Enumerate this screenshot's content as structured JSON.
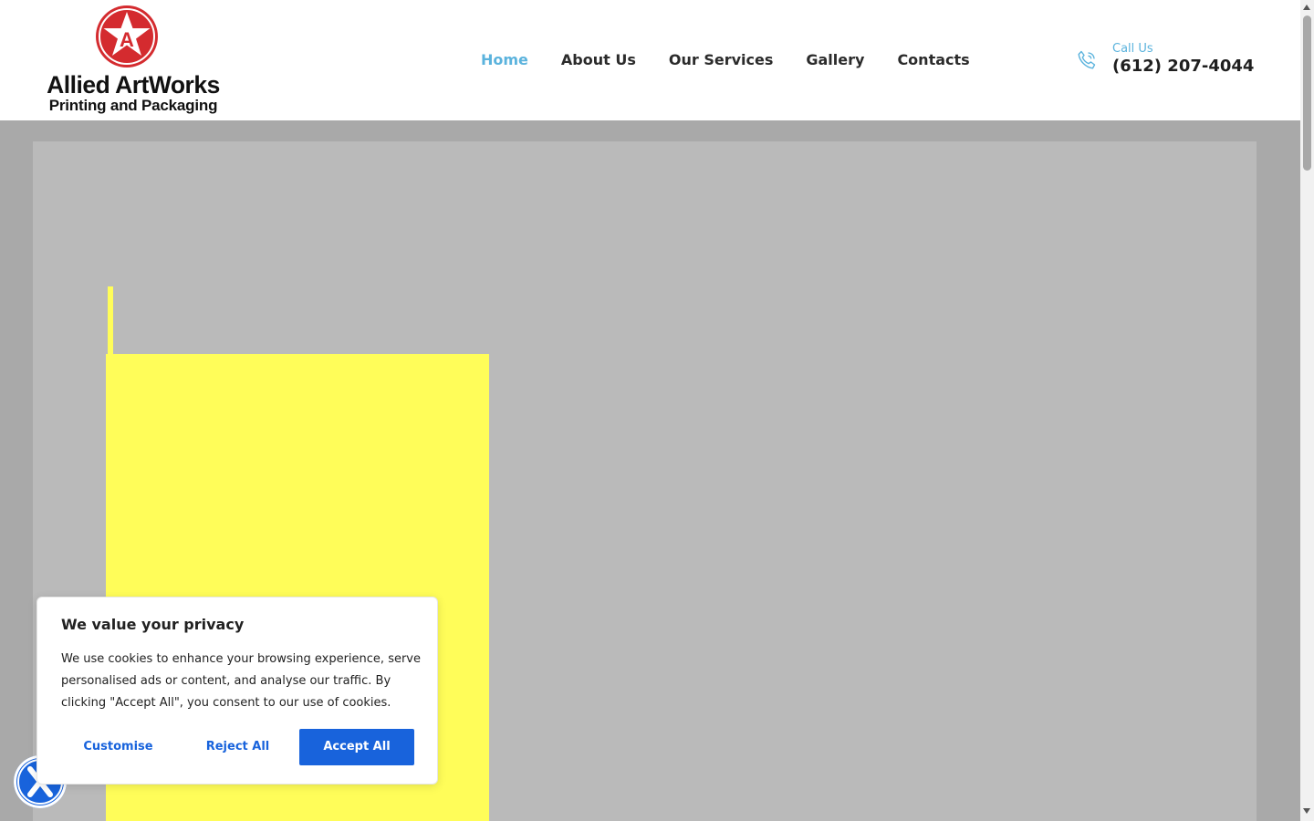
{
  "brand": {
    "title": "Allied ArtWorks",
    "subtitle": "Printing and Packaging",
    "emblem_letter": "A",
    "emblem_color": "#d42b2f"
  },
  "nav": {
    "items": [
      {
        "label": "Home",
        "active": true
      },
      {
        "label": "About Us",
        "active": false
      },
      {
        "label": "Our Services",
        "active": false
      },
      {
        "label": "Gallery",
        "active": false
      },
      {
        "label": "Contacts",
        "active": false
      }
    ],
    "active_color": "#5bb3dd"
  },
  "contact": {
    "label": "Call Us",
    "phone": "(612) 207-4044",
    "icon": "phone-icon"
  },
  "hero": {
    "accent_color": "#fffd59"
  },
  "cookie_banner": {
    "title": "We value your privacy",
    "text": "We use cookies to enhance your browsing experience, serve personalised ads or content, and analyse our traffic. By clicking \"Accept All\", you consent to our use of cookies.",
    "customise_label": "Customise",
    "reject_label": "Reject All",
    "accept_label": "Accept All",
    "button_color": "#1863dc"
  },
  "floating": {
    "icon": "close-icon"
  }
}
